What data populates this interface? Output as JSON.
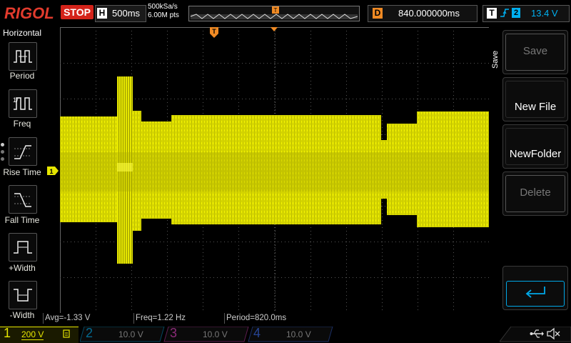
{
  "header": {
    "brand": "RIGOL",
    "run_state": "STOP",
    "timebase_label": "H",
    "timebase_value": "500ms",
    "sample_rate": "500kSa/s",
    "memory_depth": "6.00M pts",
    "trigger_marker": "T",
    "delay_label": "D",
    "delay_value": "840.000000ms",
    "trigger_label": "T",
    "trigger_edge": "rising-edge-icon",
    "trigger_source": "2",
    "trigger_level": "13.4 V"
  },
  "left_menu": {
    "title": "Horizontal",
    "items": [
      {
        "label": "Period",
        "icon": "period-icon"
      },
      {
        "label": "Freq",
        "icon": "frequency-icon"
      },
      {
        "label": "Rise Time",
        "icon": "rise-time-icon"
      },
      {
        "label": "Fall Time",
        "icon": "fall-time-icon"
      },
      {
        "label": "+Width",
        "icon": "positive-width-icon"
      },
      {
        "label": "-Width",
        "icon": "negative-width-icon"
      }
    ]
  },
  "right_menu": {
    "title": "Save",
    "items": [
      {
        "label": "Save",
        "enabled": false
      },
      {
        "label": "New File",
        "enabled": true
      },
      {
        "label": "NewFolder",
        "enabled": true
      },
      {
        "label": "Delete",
        "enabled": false
      },
      {
        "label": "",
        "icon": "enter-return-icon",
        "enabled": true
      }
    ]
  },
  "measurements": {
    "avg": "Avg=-1.33 V",
    "freq": "Freq=1.22 Hz",
    "period": "Period=820.0ms"
  },
  "channels": [
    {
      "num": "1",
      "scale": "200 V",
      "color": "#f0f000",
      "active": true
    },
    {
      "num": "2",
      "scale": "10.0 V",
      "color": "#00a8e8",
      "active": false
    },
    {
      "num": "3",
      "scale": "10.0 V",
      "color": "#e040c0",
      "active": false
    },
    {
      "num": "4",
      "scale": "10.0 V",
      "color": "#3a6cf0",
      "active": false
    }
  ],
  "channel1_marker": "1",
  "colors": {
    "trace": "#e6e600",
    "brand": "#e23b2d",
    "stop": "#d4231a",
    "trigger": "#f08a24",
    "trigger_source": "#00b0f0"
  },
  "status_icons": [
    "usb-icon",
    "mute-icon"
  ]
}
